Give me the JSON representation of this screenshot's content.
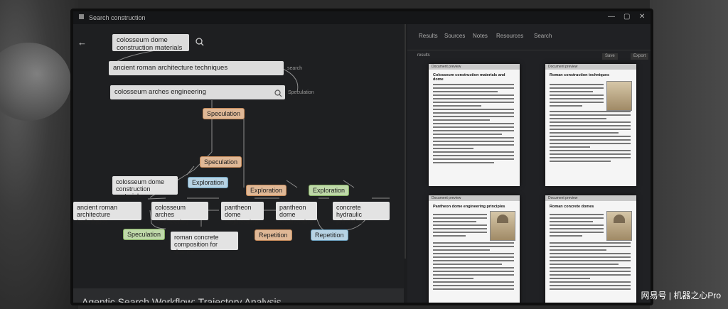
{
  "window": {
    "title": "Search construction",
    "controls": [
      "—",
      "▢",
      "✕"
    ]
  },
  "left": {
    "back_icon": "arrow-left-icon",
    "queries": [
      {
        "text": "colosseum dome construction materials"
      },
      {
        "text": "ancient roman architecture techniques",
        "side": "search"
      },
      {
        "text": "colosseum arches engineering",
        "side": "Speculation"
      }
    ],
    "tags": {
      "speculation1": "Speculation",
      "speculation2": "Speculation",
      "exploration1": "Exploration",
      "exploration2": "Exploration",
      "exploration3": "Exploration",
      "speculation3": "Speculation",
      "repetition1": "Repetition",
      "repetition2": "Repetition"
    },
    "nodes": {
      "n1": "colosseum dome construction materials",
      "n2": "ancient roman architecture techniques",
      "n3": "colosseum arches engineering",
      "n4": "pantheon dome engineering",
      "n5": "pantheon dome engineering",
      "n6": "concrete hydraulic principles",
      "n7": "roman concrete composition for domes"
    },
    "caption": "Agentic Search Workflow: Trajectory Analysis"
  },
  "right": {
    "tabs": [
      "Results",
      "Sources",
      "Notes",
      "Resources",
      "Search"
    ],
    "bar_label": "results",
    "buttons": [
      "Save",
      "Export"
    ],
    "docs": [
      {
        "header": "Document preview",
        "title": "Colosseum construction materials and dome"
      },
      {
        "header": "Document preview",
        "title": "Roman construction techniques"
      },
      {
        "header": "Document preview",
        "title": "Pantheon dome engineering principles"
      },
      {
        "header": "Document preview",
        "title": "Roman concrete domes"
      }
    ]
  },
  "watermark": "网易号 | 机器之心Pro"
}
